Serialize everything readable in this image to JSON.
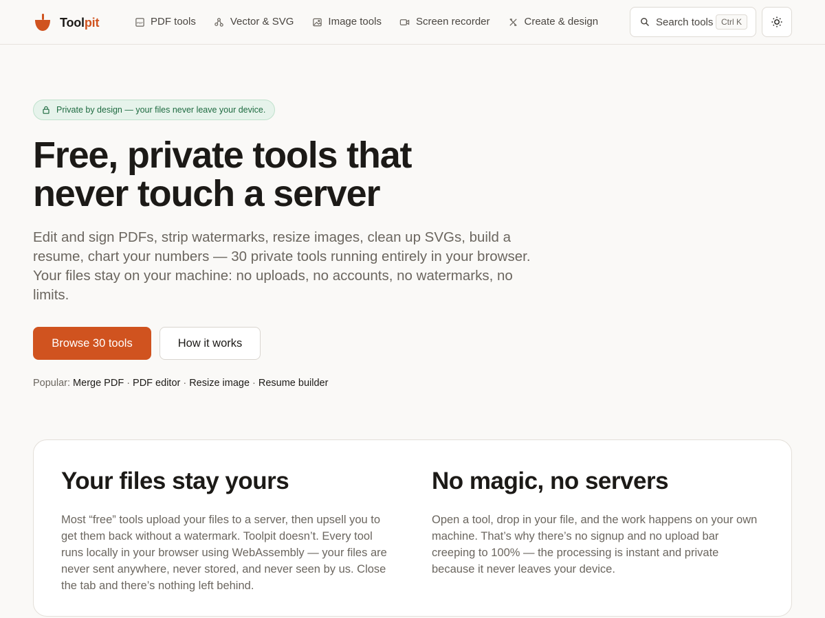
{
  "colors": {
    "accent": "#d0531f",
    "badge_bg": "#e6f3eb",
    "badge_text": "#1f6b41",
    "text": "#1c1a17",
    "muted": "#6b665f"
  },
  "header": {
    "brand_main": "Tool",
    "brand_accent": "pit",
    "logo_icon": "mortar-bowl-icon",
    "nav": [
      {
        "label": "PDF tools",
        "icon": "pdf-file-icon"
      },
      {
        "label": "Vector & SVG",
        "icon": "vector-nodes-icon"
      },
      {
        "label": "Image tools",
        "icon": "image-icon"
      },
      {
        "label": "Screen recorder",
        "icon": "video-camera-icon"
      },
      {
        "label": "Create & design",
        "icon": "design-tools-icon"
      }
    ],
    "search": {
      "label": "Search tools",
      "shortcut": "Ctrl K",
      "icon": "search-icon"
    },
    "theme_toggle_icon": "sun-icon"
  },
  "hero": {
    "badge": "Private by design — your files never leave your device.",
    "badge_icon": "lock-icon",
    "title_line1": "Free, private tools that",
    "title_line2": "never touch a server",
    "subtitle": "Edit and sign PDFs, strip watermarks, resize images, clean up SVGs, build a resume, chart your numbers — 30 private tools running entirely in your browser. Your files stay on your machine: no uploads, no accounts, no watermarks, no limits.",
    "primary_button": "Browse 30 tools",
    "secondary_button": "How it works",
    "popular_label": "Popular:",
    "popular_links": [
      "Merge PDF",
      "PDF editor",
      "Resize image",
      "Resume builder"
    ],
    "popular_sep": "·"
  },
  "features": [
    {
      "title": "Your files stay yours",
      "body": "Most “free” tools upload your files to a server, then upsell you to get them back without a watermark. Toolpit doesn’t. Every tool runs locally in your browser using WebAssembly — your files are never sent anywhere, never stored, and never seen by us. Close the tab and there’s nothing left behind."
    },
    {
      "title": "No magic, no servers",
      "body": "Open a tool, drop in your file, and the work happens on your own machine. That’s why there’s no signup and no upload bar creeping to 100% — the processing is instant and private because it never leaves your device."
    }
  ]
}
